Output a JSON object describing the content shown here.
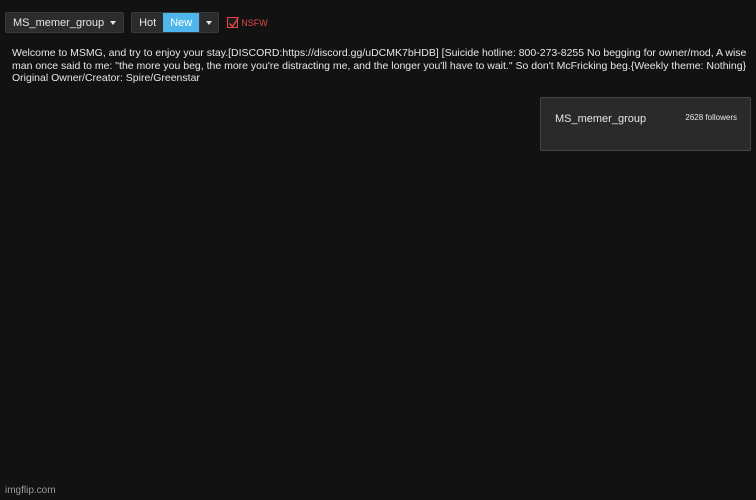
{
  "toolbar": {
    "stream_select": "MS_memer_group",
    "sort_options": [
      "Hot",
      "New"
    ],
    "active_sort": "New",
    "nsfw_label": "NSFW",
    "nsfw_checked": true
  },
  "description": "Welcome to MSMG, and try to enjoy your stay.[DISCORD:https://discord.gg/uDCMK7bHDB] [Suicide hotline: 800-273-8255 No begging for owner/mod, A wise man once said to me: \"the more you beg, the more you're distracting me, and the longer you'll have to wait.\" So don't McFricking beg.{Weekly theme: Nothing} Original Owner/Creator: Spire/Greenstar",
  "stream_card": {
    "name": "MS_memer_group",
    "followers": "2628 followers"
  },
  "watermark": "imgflip.com",
  "colors": {
    "background": "#121212",
    "active_accent": "#4fb6ec",
    "nsfw_red": "#e04848",
    "card_bg": "#2a2a2a"
  },
  "icons": {
    "dropdown": "chevron-down-icon",
    "nsfw": "checkmark-icon"
  }
}
